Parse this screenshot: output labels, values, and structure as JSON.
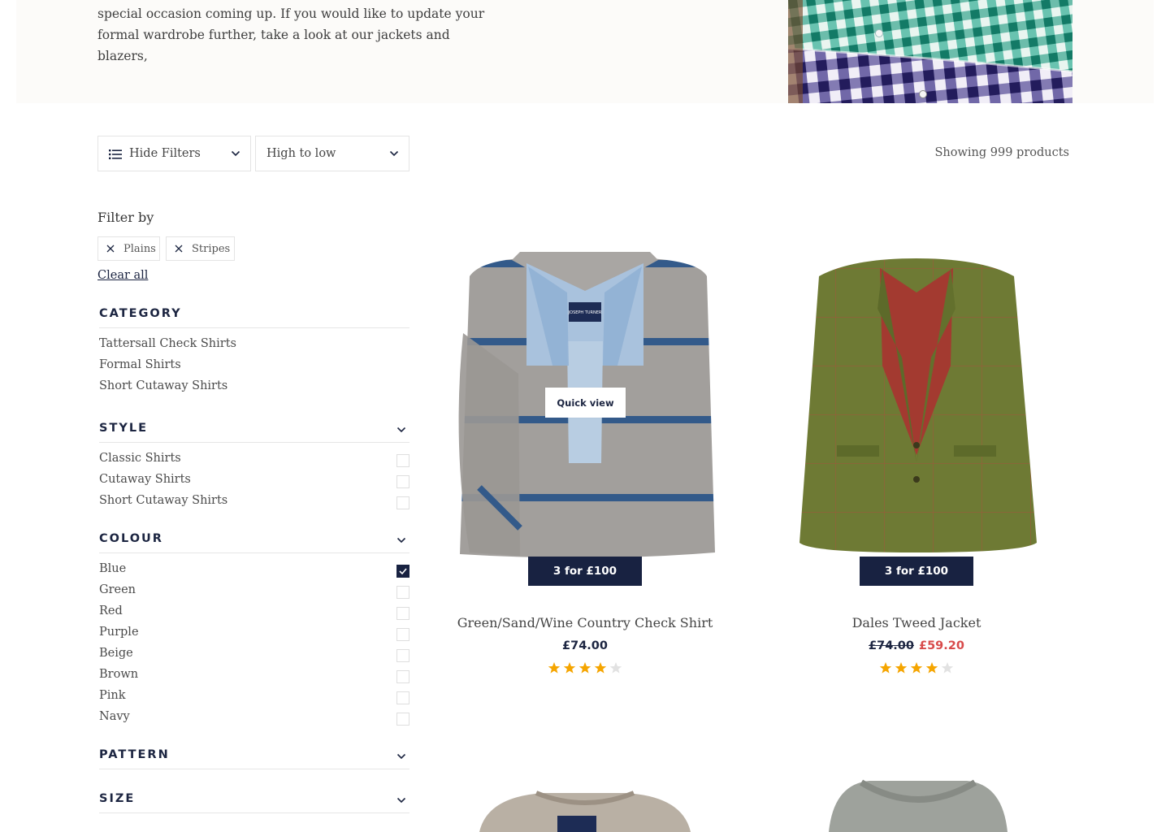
{
  "hero": {
    "text_line1": "special occasion coming up. If you would like to update your",
    "text_line2": "formal wardrobe further, take a look at our jackets and blazers,"
  },
  "toolbar": {
    "hide_filters_label": "Hide Filters",
    "sort_value": "High to low",
    "product_count": "Showing 999 products"
  },
  "filters": {
    "heading": "Filter by",
    "active_chips": [
      "Plains",
      "Stripes"
    ],
    "clear_all": "Clear all",
    "facets": [
      {
        "title": "CATEGORY",
        "expanded": true,
        "items": [
          {
            "label": "Tattersall Check Shirts"
          },
          {
            "label": "Formal Shirts"
          },
          {
            "label": "Short Cutaway Shirts"
          }
        ]
      },
      {
        "title": "STYLE",
        "expanded": true,
        "items": [
          {
            "label": "Classic Shirts",
            "checked": false
          },
          {
            "label": "Cutaway Shirts",
            "checked": false
          },
          {
            "label": "Short Cutaway Shirts",
            "checked": false
          }
        ]
      },
      {
        "title": "COLOUR",
        "expanded": true,
        "items": [
          {
            "label": "Blue",
            "checked": true
          },
          {
            "label": "Green",
            "checked": false
          },
          {
            "label": "Red",
            "checked": false
          },
          {
            "label": "Purple",
            "checked": false
          },
          {
            "label": "Beige",
            "checked": false
          },
          {
            "label": "Brown",
            "checked": false
          },
          {
            "label": "Pink",
            "checked": false
          },
          {
            "label": "Navy",
            "checked": false
          }
        ]
      },
      {
        "title": "PATTERN",
        "expanded": false,
        "items": []
      },
      {
        "title": "SIZE",
        "expanded": false,
        "items": []
      }
    ]
  },
  "products": [
    {
      "name": "Green/Sand/Wine Country Check Shirt",
      "price": "£74.00",
      "offer": "3 for £100",
      "quick_view": "Quick view",
      "rating": 4
    },
    {
      "name": "Dales Tweed Jacket",
      "was_price": "£74.00",
      "price": "£59.20",
      "offer": "3 for £100",
      "rating": 4
    }
  ],
  "colors": {
    "navy": "#182241",
    "star": "#f5a500",
    "star_empty": "#e2e2e2",
    "sale": "#d84a4a"
  }
}
